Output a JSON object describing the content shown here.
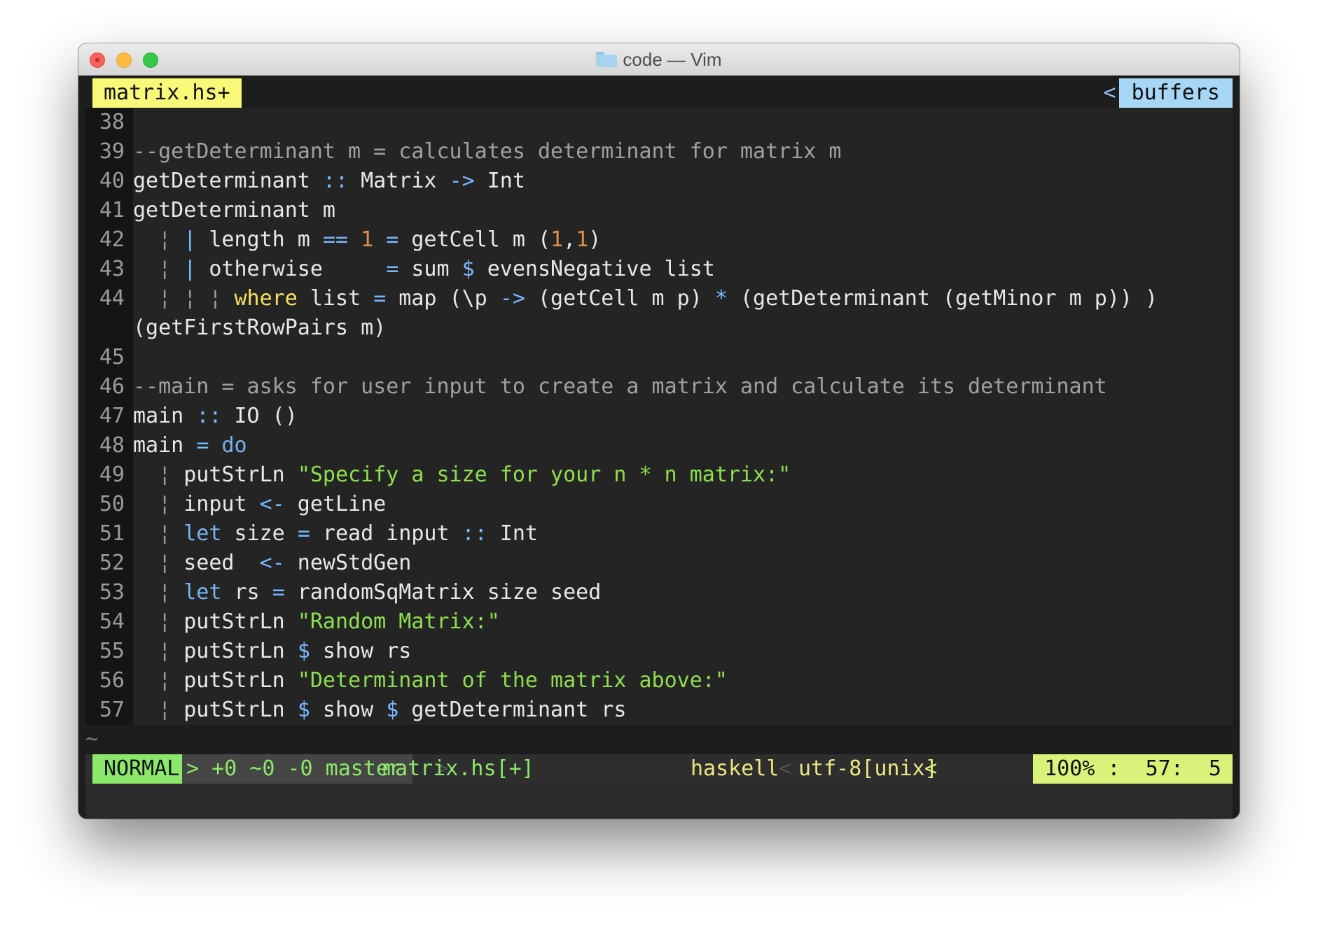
{
  "window": {
    "title": "code — Vim",
    "folder_icon": "folder-icon"
  },
  "tabline": {
    "active_tab": "matrix.hs+",
    "buffers_sep": "<",
    "buffers_label": "buffers"
  },
  "lines": [
    {
      "n": "38",
      "code": ""
    },
    {
      "n": "39",
      "code": "--getDeterminant m = calculates determinant for matrix m"
    },
    {
      "n": "40",
      "code": "getDeterminant :: Matrix -> Int"
    },
    {
      "n": "41",
      "code": "getDeterminant m"
    },
    {
      "n": "42",
      "code": "  ¦ | length m == 1 = getCell m (1,1)"
    },
    {
      "n": "43",
      "code": "  ¦ | otherwise     = sum $ evensNegative list"
    },
    {
      "n": "44",
      "code": "  ¦ ¦ ¦ where list = map (\\p -> (getCell m p) * (getDeterminant (getMinor m p)) )"
    },
    {
      "n": "",
      "code": "(getFirstRowPairs m)"
    },
    {
      "n": "45",
      "code": ""
    },
    {
      "n": "46",
      "code": "--main = asks for user input to create a matrix and calculate its determinant"
    },
    {
      "n": "47",
      "code": "main :: IO ()"
    },
    {
      "n": "48",
      "code": "main = do"
    },
    {
      "n": "49",
      "code": "  ¦ putStrLn \"Specify a size for your n * n matrix:\""
    },
    {
      "n": "50",
      "code": "  ¦ input <- getLine"
    },
    {
      "n": "51",
      "code": "  ¦ let size = read input :: Int"
    },
    {
      "n": "52",
      "code": "  ¦ seed  <- newStdGen"
    },
    {
      "n": "53",
      "code": "  ¦ let rs = randomSqMatrix size seed"
    },
    {
      "n": "54",
      "code": "  ¦ putStrLn \"Random Matrix:\""
    },
    {
      "n": "55",
      "code": "  ¦ putStrLn $ show rs"
    },
    {
      "n": "56",
      "code": "  ¦ putStrLn \"Determinant of the matrix above:\""
    },
    {
      "n": "57",
      "code": "  ¦ putStrLn $ show $ getDeterminant rs"
    }
  ],
  "tilde": "~",
  "statusline": {
    "mode": "NORMAL",
    "git": "> +0 ~0 -0 master",
    "git_sep": ">",
    "filename": "matrix.hs[+]",
    "filetype": "haskell",
    "enc_sep": "<",
    "encoding": "utf-8[unix]",
    "pos_sep": "<",
    "position": "100% :  57:  5"
  }
}
